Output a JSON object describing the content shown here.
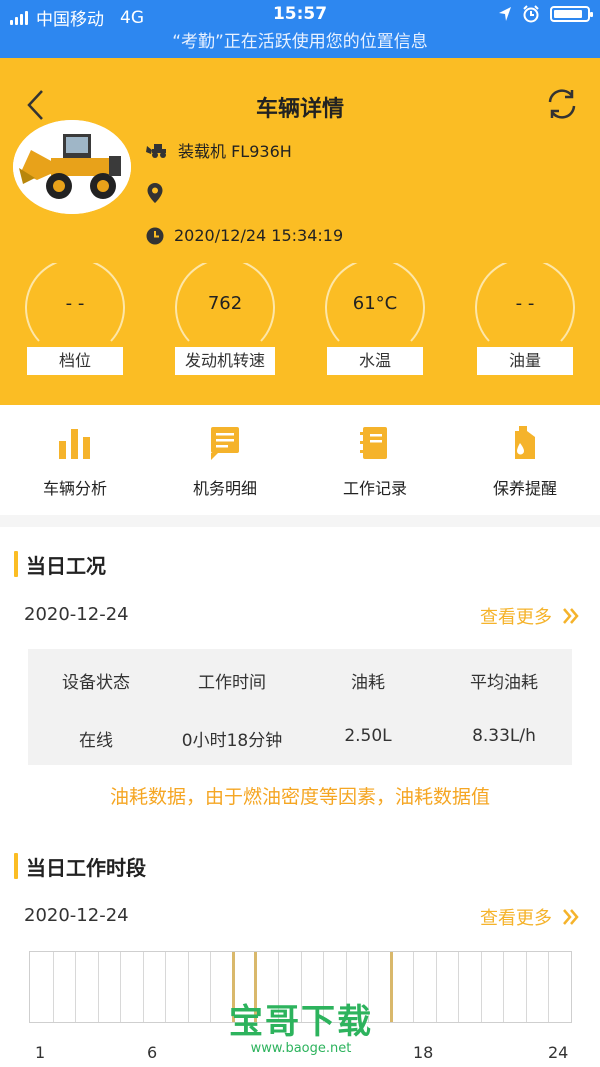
{
  "status_bar": {
    "carrier": "中国移动",
    "network": "4G",
    "time": "15:57",
    "icons": [
      "signal-icon",
      "location-arrow-icon",
      "alarm-icon",
      "battery-icon"
    ]
  },
  "location_banner": "“考勤”正在活跃使用您的位置信息",
  "header": {
    "title": "车辆详情",
    "back_icon": "back-chevron-icon",
    "refresh_icon": "refresh-icon",
    "vehicle_name": "装载机 FL936H",
    "location": "",
    "timestamp": "2020/12/24 15:34:19",
    "accent": "#fbbd24"
  },
  "gauges": [
    {
      "value": "- -",
      "label": "档位"
    },
    {
      "value": "762",
      "label": "发动机转速"
    },
    {
      "value": "61°C",
      "label": "水温"
    },
    {
      "value": "- -",
      "label": "油量"
    }
  ],
  "menu": [
    {
      "label": "车辆分析",
      "icon": "bar-chart-icon"
    },
    {
      "label": "机务明细",
      "icon": "message-list-icon"
    },
    {
      "label": "工作记录",
      "icon": "notebook-icon"
    },
    {
      "label": "保养提醒",
      "icon": "fuel-can-icon"
    }
  ],
  "daily_status": {
    "title": "当日工况",
    "date": "2020-12-24",
    "more_label": "查看更多",
    "columns": [
      "设备状态",
      "工作时间",
      "油耗",
      "平均油耗"
    ],
    "values": [
      "在线",
      "0小时18分钟",
      "2.50L",
      "8.33L/h"
    ],
    "notice": "油耗数据，由于燃油密度等因素，油耗数据值"
  },
  "work_periods": {
    "title": "当日工作时段",
    "date": "2020-12-24",
    "more_label": "查看更多",
    "axis_labels": [
      "1",
      "6",
      "18",
      "24"
    ],
    "active_hours": [
      9,
      10,
      16
    ]
  },
  "watermark": {
    "text": "宝哥下载",
    "url": "www.baoge.net"
  }
}
